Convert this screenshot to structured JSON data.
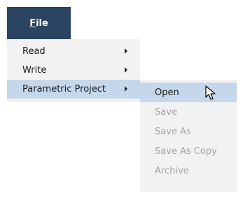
{
  "file_tab": {
    "label_mnemonic": "F",
    "label_rest": "ile"
  },
  "main_menu": {
    "items": [
      {
        "label": "Read",
        "has_submenu": true
      },
      {
        "label": "Write",
        "has_submenu": true
      },
      {
        "label": "Parametric Project",
        "has_submenu": true,
        "highlighted": true
      }
    ]
  },
  "submenu": {
    "items": [
      {
        "label": "Open",
        "enabled": true,
        "highlighted": true
      },
      {
        "label": "Save",
        "enabled": false
      },
      {
        "label": "Save As",
        "enabled": false
      },
      {
        "label": "Save As Copy",
        "enabled": false
      },
      {
        "label": "Archive",
        "enabled": false
      }
    ]
  },
  "colors": {
    "file_tab_bg": "#2b4462",
    "menu_bg": "#f2f2f2",
    "highlight_bg": "#c5d7ea",
    "disabled_text": "#a6a6a6"
  },
  "icons": {
    "cursor": "mouse-pointer-icon",
    "submenu_arrow": "chevron-right-icon"
  }
}
